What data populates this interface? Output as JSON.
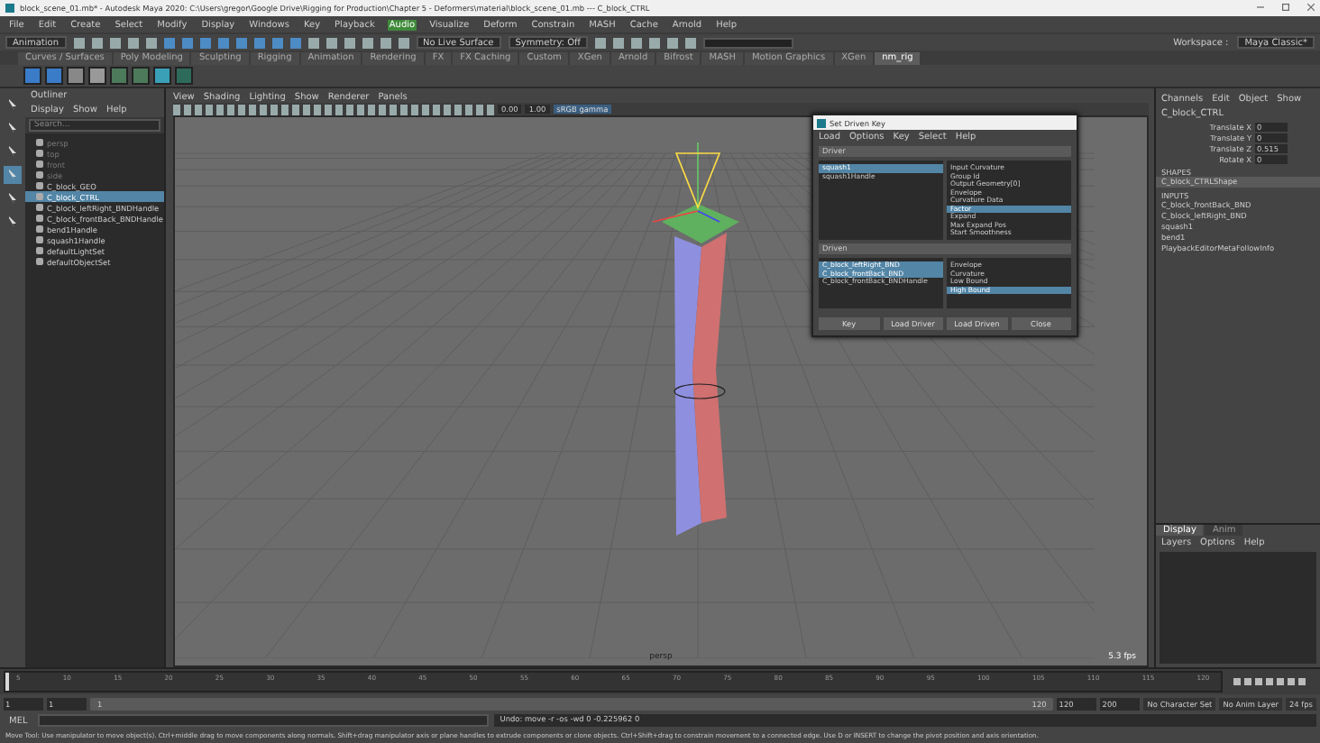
{
  "window": {
    "title": "block_scene_01.mb* - Autodesk Maya 2020: C:\\Users\\gregor\\Google Drive\\Rigging for Production\\Chapter 5 - Deformers\\material\\block_scene_01.mb --- C_block_CTRL"
  },
  "menu_bar": [
    {
      "label": "File",
      "highlighted": false
    },
    {
      "label": "Edit",
      "highlighted": false
    },
    {
      "label": "Create",
      "highlighted": false
    },
    {
      "label": "Select",
      "highlighted": false
    },
    {
      "label": "Modify",
      "highlighted": false
    },
    {
      "label": "Display",
      "highlighted": false
    },
    {
      "label": "Windows",
      "highlighted": false
    },
    {
      "label": "Key",
      "highlighted": false
    },
    {
      "label": "Playback",
      "highlighted": false
    },
    {
      "label": "Audio",
      "highlighted": true
    },
    {
      "label": "Visualize",
      "highlighted": false
    },
    {
      "label": "Deform",
      "highlighted": false
    },
    {
      "label": "Constrain",
      "highlighted": false
    },
    {
      "label": "MASH",
      "highlighted": false
    },
    {
      "label": "Cache",
      "highlighted": false
    },
    {
      "label": "Arnold",
      "highlighted": false
    },
    {
      "label": "Help",
      "highlighted": false
    }
  ],
  "status_line": {
    "menu_set": "Animation",
    "live_surface": "No Live Surface",
    "symmetry": "Symmetry: Off",
    "workspace_label": "Workspace :",
    "workspace": "Maya Classic*"
  },
  "shelf": {
    "tabs": [
      {
        "label": "Curves / Surfaces",
        "selected": false
      },
      {
        "label": "Poly Modeling",
        "selected": false
      },
      {
        "label": "Sculpting",
        "selected": false
      },
      {
        "label": "Rigging",
        "selected": false
      },
      {
        "label": "Animation",
        "selected": false
      },
      {
        "label": "Rendering",
        "selected": false
      },
      {
        "label": "FX",
        "selected": false
      },
      {
        "label": "FX Caching",
        "selected": false
      },
      {
        "label": "Custom",
        "selected": false
      },
      {
        "label": "XGen",
        "selected": false
      },
      {
        "label": "Arnold",
        "selected": false
      },
      {
        "label": "Bifrost",
        "selected": false
      },
      {
        "label": "MASH",
        "selected": false
      },
      {
        "label": "Motion Graphics",
        "selected": false
      },
      {
        "label": "XGen",
        "selected": false
      },
      {
        "label": "nm_rig",
        "selected": true
      }
    ]
  },
  "outliner": {
    "title": "Outliner",
    "menu": [
      "Display",
      "Show",
      "Help"
    ],
    "search": {
      "placeholder": "Search..."
    },
    "items": [
      {
        "label": "persp",
        "selected": false,
        "dimmed": true
      },
      {
        "label": "top",
        "selected": false,
        "dimmed": true
      },
      {
        "label": "front",
        "selected": false,
        "dimmed": true
      },
      {
        "label": "side",
        "selected": false,
        "dimmed": true
      },
      {
        "label": "C_block_GEO",
        "selected": false,
        "dimmed": false
      },
      {
        "label": "C_block_CTRL",
        "selected": true,
        "dimmed": false
      },
      {
        "label": "C_block_leftRight_BNDHandle",
        "selected": false,
        "dimmed": false
      },
      {
        "label": "C_block_frontBack_BNDHandle",
        "selected": false,
        "dimmed": false
      },
      {
        "label": "bend1Handle",
        "selected": false,
        "dimmed": false
      },
      {
        "label": "squash1Handle",
        "selected": false,
        "dimmed": false
      },
      {
        "label": "defaultLightSet",
        "selected": false,
        "dimmed": false
      },
      {
        "label": "defaultObjectSet",
        "selected": false,
        "dimmed": false
      }
    ]
  },
  "viewport": {
    "menu": [
      "View",
      "Shading",
      "Lighting",
      "Show",
      "Renderer",
      "Panels"
    ],
    "exposure": "0.00",
    "gamma": "1.00",
    "color_space": "sRGB gamma",
    "camera": "persp",
    "fps": "5.3 fps"
  },
  "set_driven_key": {
    "title": "Set Driven Key",
    "menu": [
      "Load",
      "Options",
      "Key",
      "Select",
      "Help"
    ],
    "driver": {
      "label": "Driver",
      "objects": [
        {
          "label": "squash1",
          "selected": true
        },
        {
          "label": "squash1Handle",
          "selected": false
        }
      ],
      "attributes": [
        {
          "label": "Input Curvature",
          "selected": false
        },
        {
          "label": "Group Id",
          "selected": false
        },
        {
          "label": "Output Geometry[0]",
          "selected": false
        },
        {
          "label": "Envelope",
          "selected": false
        },
        {
          "label": "Curvature Data",
          "selected": false
        },
        {
          "label": "Factor",
          "selected": true
        },
        {
          "label": "Expand",
          "selected": false
        },
        {
          "label": "Max Expand Pos",
          "selected": false
        },
        {
          "label": "Start Smoothness",
          "selected": false
        }
      ]
    },
    "driven": {
      "label": "Driven",
      "objects": [
        {
          "label": "C_block_leftRight_BND",
          "selected": true
        },
        {
          "label": "C_block_frontBack_BND",
          "selected": true
        },
        {
          "label": "C_block_frontBack_BNDHandle",
          "selected": false
        }
      ],
      "attributes": [
        {
          "label": "Envelope",
          "selected": false
        },
        {
          "label": "Curvature",
          "selected": false
        },
        {
          "label": "Low Bound",
          "selected": false
        },
        {
          "label": "High Bound",
          "selected": true
        }
      ]
    },
    "buttons": [
      "Key",
      "Load Driver",
      "Load Driven",
      "Close"
    ]
  },
  "channel_box": {
    "menu": [
      "Channels",
      "Edit",
      "Object",
      "Show"
    ],
    "object": "C_block_CTRL",
    "channels": [
      {
        "name": "Translate X",
        "value": "0"
      },
      {
        "name": "Translate Y",
        "value": "0"
      },
      {
        "name": "Translate Z",
        "value": "0.515"
      },
      {
        "name": "Rotate X",
        "value": "0"
      }
    ],
    "shapes_header": "SHAPES",
    "shapes": [
      {
        "label": "C_block_CTRLShape",
        "selected": true
      }
    ],
    "inputs_header": "INPUTS",
    "inputs": [
      {
        "label": "C_block_frontBack_BND",
        "selected": false
      },
      {
        "label": "C_block_leftRight_BND",
        "selected": false
      },
      {
        "label": "squash1",
        "selected": false
      },
      {
        "label": "bend1",
        "selected": false
      },
      {
        "label": "PlaybackEditorMetaFollowInfo",
        "selected": false
      }
    ]
  },
  "layer_editor": {
    "tabs": [
      {
        "label": "Display",
        "selected": true
      },
      {
        "label": "Anim",
        "selected": false
      }
    ],
    "menu": [
      "Layers",
      "Options",
      "Help"
    ]
  },
  "time_slider": {
    "level": 0,
    "ticks": [
      "5",
      "10",
      "15",
      "20",
      "25",
      "30",
      "35",
      "40",
      "45",
      "50",
      "55",
      "60",
      "65",
      "70",
      "75",
      "80",
      "85",
      "90",
      "95",
      "100",
      "105",
      "110",
      "115",
      "120"
    ]
  },
  "range_slider": {
    "start": "1",
    "playback_start": "1",
    "bar_start": "1",
    "bar_end": "120",
    "playback_end": "120",
    "end": "200",
    "character_set": "No Character Set",
    "anim_layer": "No Anim Layer",
    "fps": "24 fps"
  },
  "command_line": {
    "language": "MEL",
    "result": "Undo: move -r -os -wd 0 -0.225962 0"
  },
  "help_line": "Move Tool: Use manipulator to move object(s). Ctrl+middle drag to move components along normals. Shift+drag manipulator axis or plane handles to extrude components or clone objects. Ctrl+Shift+drag to constrain movement to a connected edge. Use D or INSERT to change the pivot position and axis orientation."
}
